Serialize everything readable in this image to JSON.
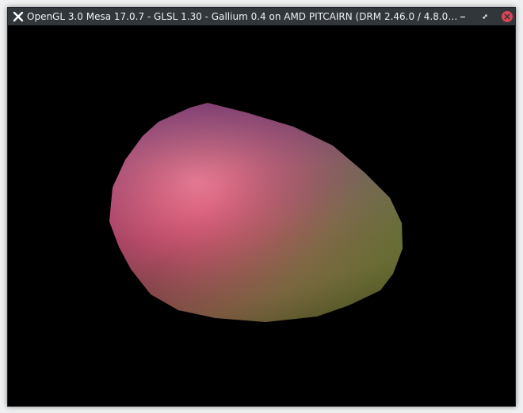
{
  "window": {
    "title": "OpenGL 3.0 Mesa 17.0.7 - GLSL 1.30 - Gallium 0.4 on AMD PITCAIRN (DRM 2.46.0 / 4.8.0-...",
    "controls": {
      "minimize_icon": "minimize-icon",
      "maximize_icon": "restore-icon",
      "close_icon": "close-icon"
    },
    "app_icon": "x-app-icon"
  },
  "colors": {
    "titlebar_bg": "#31363b",
    "titlebar_text": "#eff0f1",
    "close_button": "#da4453",
    "canvas_bg": "#000000",
    "shape_highlight": "#ff7090",
    "shape_magenta": "#8a2a78",
    "shape_green": "#557a3a"
  }
}
